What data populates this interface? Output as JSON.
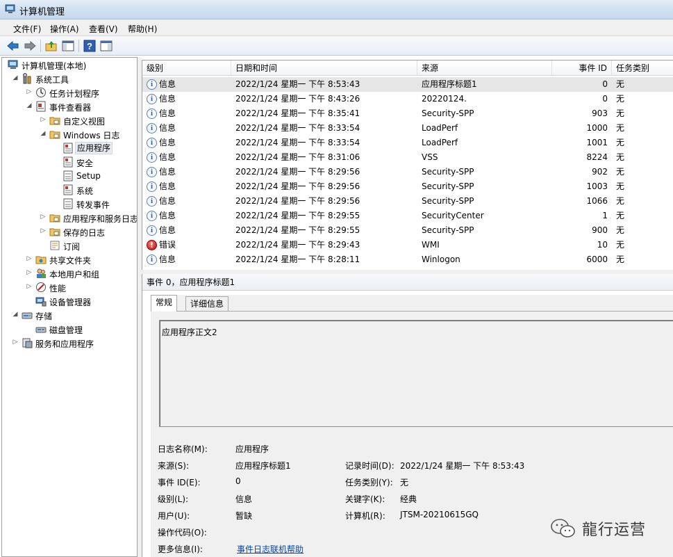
{
  "window": {
    "title": "计算机管理"
  },
  "menu": [
    {
      "label": "文件(F)"
    },
    {
      "label": "操作(A)"
    },
    {
      "label": "查看(V)"
    },
    {
      "label": "帮助(H)"
    }
  ],
  "tree": [
    {
      "label": "计算机管理(本地)",
      "icon": "computer-management-icon"
    },
    {
      "label": "系统工具",
      "icon": "system-tools-icon"
    },
    {
      "label": "任务计划程序",
      "icon": "task-scheduler-icon"
    },
    {
      "label": "事件查看器",
      "icon": "event-viewer-icon"
    },
    {
      "label": "自定义视图",
      "icon": "custom-views-folder-icon"
    },
    {
      "label": "Windows 日志",
      "icon": "windows-logs-folder-icon"
    },
    {
      "label": "应用程序",
      "icon": "log-icon"
    },
    {
      "label": "安全",
      "icon": "log-icon"
    },
    {
      "label": "Setup",
      "icon": "log-icon"
    },
    {
      "label": "系统",
      "icon": "log-icon"
    },
    {
      "label": "转发事件",
      "icon": "log-icon"
    },
    {
      "label": "应用程序和服务日志",
      "icon": "folder-icon"
    },
    {
      "label": "保存的日志",
      "icon": "folder-icon"
    },
    {
      "label": "订阅",
      "icon": "subscriptions-icon"
    },
    {
      "label": "共享文件夹",
      "icon": "shared-folders-icon"
    },
    {
      "label": "本地用户和组",
      "icon": "users-groups-icon"
    },
    {
      "label": "性能",
      "icon": "performance-icon"
    },
    {
      "label": "设备管理器",
      "icon": "device-manager-icon"
    },
    {
      "label": "存储",
      "icon": "storage-icon"
    },
    {
      "label": "磁盘管理",
      "icon": "disk-management-icon"
    },
    {
      "label": "服务和应用程序",
      "icon": "services-apps-icon"
    }
  ],
  "list": {
    "columns": [
      "级别",
      "日期和时间",
      "来源",
      "事件 ID",
      "任务类别"
    ],
    "rows": [
      {
        "level": "信息",
        "type": "info",
        "datetime": "2022/1/24 星期一 下午 8:53:43",
        "source": "应用程序标题1",
        "id": "0",
        "category": "无"
      },
      {
        "level": "信息",
        "type": "info",
        "datetime": "2022/1/24 星期一 下午 8:43:26",
        "source": "20220124.",
        "id": "0",
        "category": "无"
      },
      {
        "level": "信息",
        "type": "info",
        "datetime": "2022/1/24 星期一 下午 8:35:41",
        "source": "Security-SPP",
        "id": "903",
        "category": "无"
      },
      {
        "level": "信息",
        "type": "info",
        "datetime": "2022/1/24 星期一 下午 8:33:54",
        "source": "LoadPerf",
        "id": "1000",
        "category": "无"
      },
      {
        "level": "信息",
        "type": "info",
        "datetime": "2022/1/24 星期一 下午 8:33:54",
        "source": "LoadPerf",
        "id": "1001",
        "category": "无"
      },
      {
        "level": "信息",
        "type": "info",
        "datetime": "2022/1/24 星期一 下午 8:31:06",
        "source": "VSS",
        "id": "8224",
        "category": "无"
      },
      {
        "level": "信息",
        "type": "info",
        "datetime": "2022/1/24 星期一 下午 8:29:56",
        "source": "Security-SPP",
        "id": "902",
        "category": "无"
      },
      {
        "level": "信息",
        "type": "info",
        "datetime": "2022/1/24 星期一 下午 8:29:56",
        "source": "Security-SPP",
        "id": "1003",
        "category": "无"
      },
      {
        "level": "信息",
        "type": "info",
        "datetime": "2022/1/24 星期一 下午 8:29:56",
        "source": "Security-SPP",
        "id": "1066",
        "category": "无"
      },
      {
        "level": "信息",
        "type": "info",
        "datetime": "2022/1/24 星期一 下午 8:29:55",
        "source": "SecurityCenter",
        "id": "1",
        "category": "无"
      },
      {
        "level": "信息",
        "type": "info",
        "datetime": "2022/1/24 星期一 下午 8:29:55",
        "source": "Security-SPP",
        "id": "900",
        "category": "无"
      },
      {
        "level": "错误",
        "type": "error",
        "datetime": "2022/1/24 星期一 下午 8:29:43",
        "source": "WMI",
        "id": "10",
        "category": "无"
      },
      {
        "level": "信息",
        "type": "info",
        "datetime": "2022/1/24 星期一 下午 8:28:11",
        "source": "Winlogon",
        "id": "6000",
        "category": "无"
      }
    ]
  },
  "detail": {
    "title": "事件 0，应用程序标题1",
    "tabs": [
      "常规",
      "详细信息"
    ],
    "description": "应用程序正文2",
    "fields": {
      "log_name_label": "日志名称(M):",
      "log_name": "应用程序",
      "source_label": "来源(S):",
      "source": "应用程序标题1",
      "logged_label": "记录时间(D):",
      "logged": "2022/1/24 星期一 下午 8:53:43",
      "event_id_label": "事件 ID(E):",
      "event_id": "0",
      "task_category_label": "任务类别(Y):",
      "task_category": "无",
      "level_label": "级别(L):",
      "level": "信息",
      "keywords_label": "关键字(K):",
      "keywords": "经典",
      "user_label": "用户(U):",
      "user": "暂缺",
      "computer_label": "计算机(R):",
      "computer": "JTSM-20210615GQ",
      "opcode_label": "操作代码(O):",
      "opcode": "",
      "more_info_label": "更多信息(I):",
      "more_info_link": "事件日志联机帮助"
    }
  },
  "watermark": {
    "text": "龍行运营"
  }
}
